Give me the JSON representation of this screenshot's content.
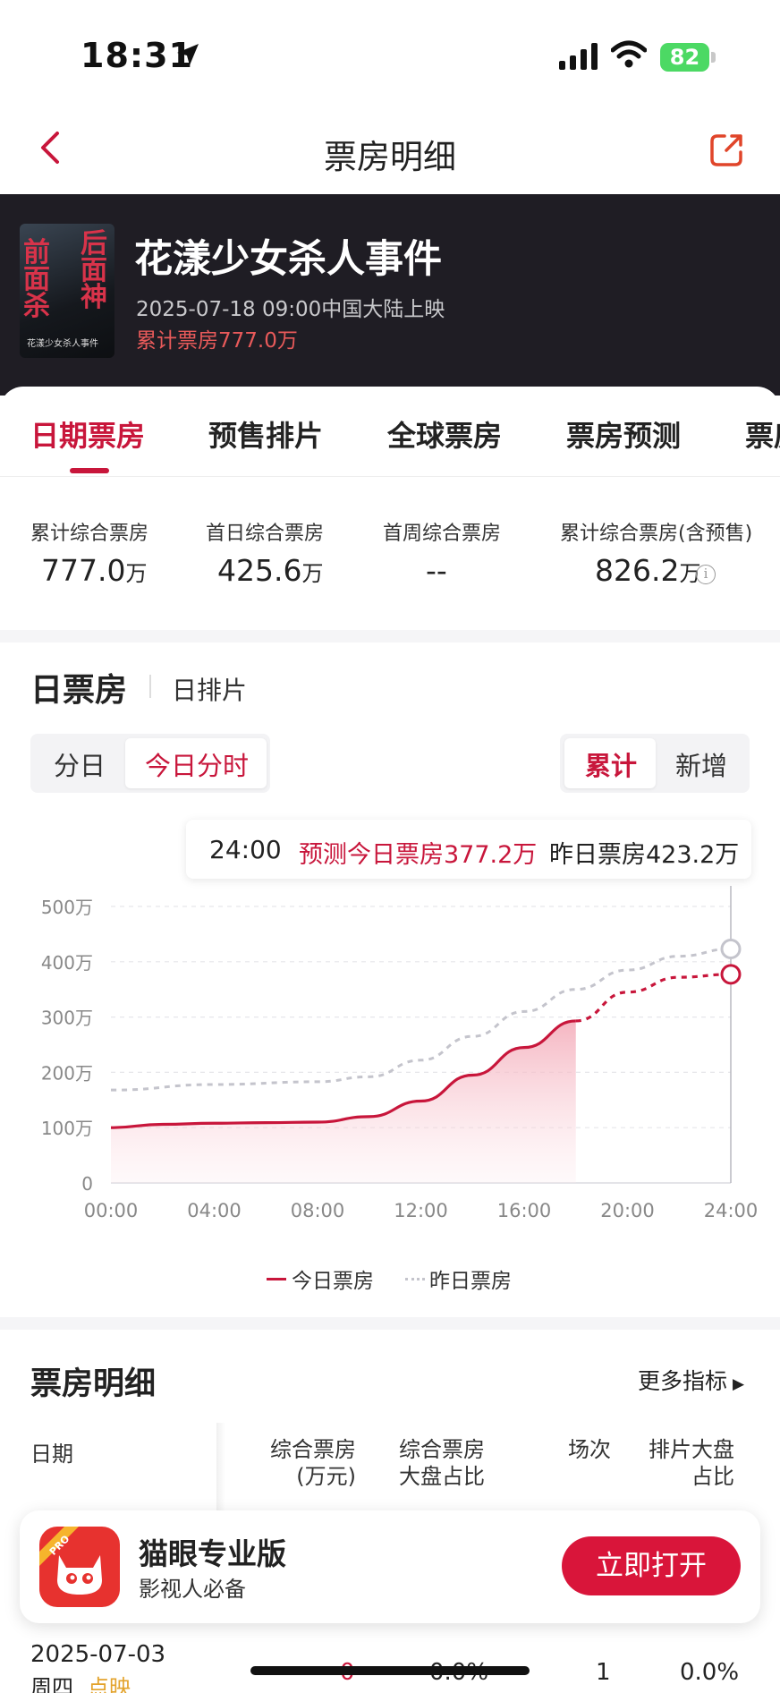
{
  "status_bar": {
    "time": "18:31",
    "battery": "82"
  },
  "nav": {
    "title": "票房明细"
  },
  "movie": {
    "poster_text_left": "前面杀",
    "poster_text_right": "后面神",
    "poster_bottom": "花漾少女杀人事件",
    "title": "花漾少女杀人事件",
    "release": "2025-07-18 09:00中国大陆上映",
    "total": "累计票房777.0万"
  },
  "tabs": [
    {
      "label": "日期票房",
      "active": true
    },
    {
      "label": "预售排片"
    },
    {
      "label": "全球票房"
    },
    {
      "label": "票房预测"
    },
    {
      "label": "票房"
    }
  ],
  "stats": [
    {
      "label": "累计综合票房",
      "value": "777.0",
      "unit": "万"
    },
    {
      "label": "首日综合票房",
      "value": "425.6",
      "unit": "万"
    },
    {
      "label": "首周综合票房",
      "value": "--",
      "unit": ""
    },
    {
      "label": "累计综合票房(含预售)",
      "value": "826.2",
      "unit": "万"
    }
  ],
  "section": {
    "title": "日票房",
    "subtitle": "日排片"
  },
  "segment_left": [
    "分日",
    "今日分时"
  ],
  "segment_right": [
    "累计",
    "新增"
  ],
  "tooltip": {
    "time": "24:00",
    "predicted": "预测今日票房377.2万",
    "yesterday": "昨日票房423.2万"
  },
  "chart_data": {
    "type": "line",
    "x_ticks": [
      "00:00",
      "04:00",
      "08:00",
      "12:00",
      "16:00",
      "20:00",
      "24:00"
    ],
    "y_ticks": [
      "0",
      "100万",
      "200万",
      "300万",
      "400万",
      "500万"
    ],
    "ylim": [
      0,
      500
    ],
    "series": [
      {
        "name": "今日票房",
        "color": "#c8163b",
        "actual_until_hour": 18,
        "points": [
          [
            0,
            100
          ],
          [
            2,
            106
          ],
          [
            4,
            108
          ],
          [
            6,
            109
          ],
          [
            8,
            110
          ],
          [
            10,
            120
          ],
          [
            12,
            148
          ],
          [
            14,
            195
          ],
          [
            16,
            245
          ],
          [
            18,
            293
          ],
          [
            20,
            345
          ],
          [
            22,
            372
          ],
          [
            24,
            377.2
          ]
        ]
      },
      {
        "name": "昨日票房",
        "color": "#c4c4cc",
        "points": [
          [
            0,
            168
          ],
          [
            4,
            178
          ],
          [
            8,
            183
          ],
          [
            10,
            192
          ],
          [
            12,
            222
          ],
          [
            14,
            265
          ],
          [
            16,
            310
          ],
          [
            18,
            350
          ],
          [
            20,
            385
          ],
          [
            22,
            410
          ],
          [
            24,
            423.2
          ]
        ]
      }
    ]
  },
  "legend": [
    "今日票房",
    "昨日票房"
  ],
  "detail": {
    "title": "票房明细",
    "more": "更多指标",
    "headers": [
      "日期",
      "综合票房\n(万元)",
      "综合票房\n大盘占比",
      "场次",
      "排片大盘\n占比"
    ],
    "row": {
      "date": "2025-07-03",
      "day": "周四",
      "tag": "点映",
      "box": "0",
      "share": "0.0%",
      "shows": "1",
      "schedule": "0.0%"
    }
  },
  "banner": {
    "name": "猫眼专业版",
    "slogan": "影视人必备",
    "badge": "PRO",
    "button": "立即打开"
  }
}
